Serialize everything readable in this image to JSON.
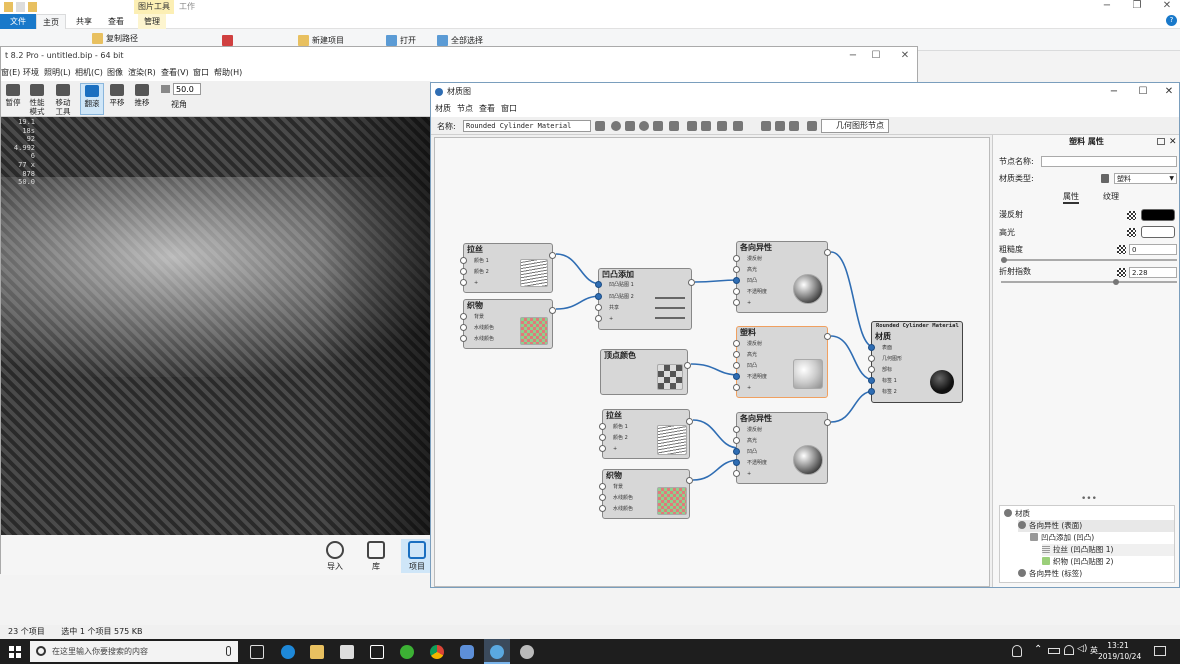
{
  "explorer": {
    "picture_tools": "图片工具",
    "work": "工作",
    "tabs": [
      "文件",
      "主页",
      "共享",
      "查看",
      "管理"
    ],
    "ribbon": {
      "copy_path": "复制路径",
      "new_item": "新建项目",
      "open": "打开",
      "select_all": "全部选择"
    },
    "status": {
      "item_count": "23 个项目",
      "selected": "选中 1 个项目  575 KB"
    }
  },
  "keyshot": {
    "title": "t 8.2 Pro  - untitled.bip  - 64 bit",
    "menu": [
      "窗(E)",
      "环境",
      "照明(L)",
      "相机(C)",
      "图像",
      "渲染(R)",
      "查看(V)",
      "窗口",
      "帮助(H)"
    ],
    "tools": [
      {
        "label": "暂停",
        "sub": ""
      },
      {
        "label": "性能",
        "sub": "模式"
      },
      {
        "label": "移动",
        "sub": "工具"
      },
      {
        "label": "翻滚",
        "sub": ""
      },
      {
        "label": "平移",
        "sub": ""
      },
      {
        "label": "推移",
        "sub": ""
      }
    ],
    "fov_value": "50.0",
    "fov_label": "视角",
    "stats": [
      "19.1",
      "18s",
      "92",
      "4.992",
      "6",
      "77 x 878",
      "50.0"
    ],
    "bottom": [
      {
        "label": "导入"
      },
      {
        "label": "库"
      },
      {
        "label": "项目"
      }
    ]
  },
  "material_graph": {
    "title": "材质图",
    "menu": [
      "材质",
      "节点",
      "查看",
      "窗口"
    ],
    "name_label": "名称:",
    "material_name": "Rounded Cylinder Material",
    "geometry_button": "几何图形节点",
    "nodes": {
      "brushed1": {
        "title": "拉丝",
        "ports": [
          "颜色 1",
          "颜色 2",
          "+"
        ]
      },
      "weave1": {
        "title": "织物",
        "ports": [
          "背景",
          "水线颜色",
          "水线颜色"
        ]
      },
      "bump_add": {
        "title": "凹凸添加",
        "ports": [
          "凹凸贴图 1",
          "凹凸贴图 2",
          "共享",
          "+"
        ]
      },
      "aniso1": {
        "title": "各向异性",
        "ports": [
          "漫反射",
          "高光",
          "凹凸",
          "不透明度",
          "+"
        ]
      },
      "plastic": {
        "title": "塑料",
        "ports": [
          "漫反射",
          "高光",
          "凹凸",
          "不透明度",
          "+"
        ]
      },
      "vertex_color": {
        "title": "顶点颜色",
        "ports": []
      },
      "brushed2": {
        "title": "拉丝",
        "ports": [
          "颜色 1",
          "颜色 2",
          "+"
        ]
      },
      "aniso2": {
        "title": "各向异性",
        "ports": [
          "漫反射",
          "高光",
          "凹凸",
          "不透明度",
          "+"
        ]
      },
      "weave2": {
        "title": "织物",
        "ports": [
          "背景",
          "水线颜色",
          "水线颜色"
        ]
      },
      "material_out": {
        "header": "Rounded Cylinder Material",
        "title": "材质",
        "ports": [
          "表面",
          "几何图形",
          "部标",
          "标签 1",
          "标签 2"
        ]
      }
    },
    "properties": {
      "title": "塑料 属性",
      "node_name_label": "节点名称:",
      "material_type_label": "材质类型:",
      "material_type_value": "塑料",
      "tabs": [
        "属性",
        "纹理"
      ],
      "diffuse_label": "漫反射",
      "diffuse_color": "#000000",
      "specular_label": "高光",
      "specular_color": "#ffffff",
      "roughness_label": "粗糙度",
      "roughness_value": "0",
      "ior_label": "折射指数",
      "ior_value": "2.28"
    },
    "tree": [
      {
        "label": "材质",
        "indent": 0
      },
      {
        "label": "各向异性 (表面)",
        "indent": 1
      },
      {
        "label": "凹凸添加 (凹凸)",
        "indent": 2
      },
      {
        "label": "拉丝 (凹凸贴图 1)",
        "indent": 3
      },
      {
        "label": "织物 (凹凸贴图 2)",
        "indent": 3
      },
      {
        "label": "各向异性 (标签)",
        "indent": 1
      }
    ]
  },
  "taskbar": {
    "search_placeholder": "在这里输入你要搜索的内容",
    "ime": "英",
    "time": "13:21",
    "date": "2019/10/24"
  }
}
